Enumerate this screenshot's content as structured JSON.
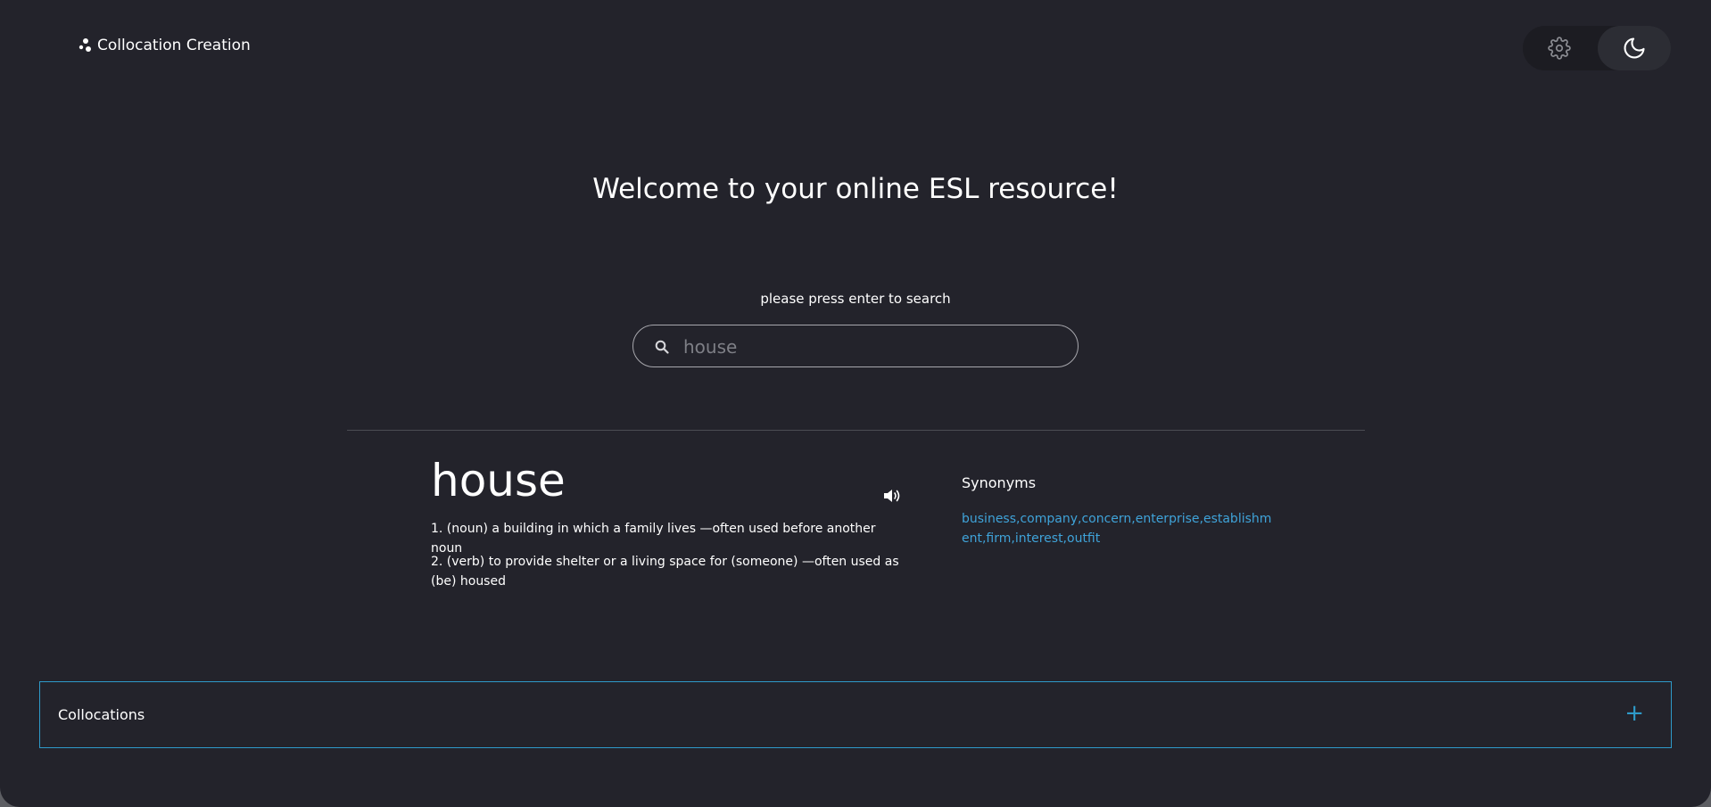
{
  "header": {
    "app_name": "Collocation Creation",
    "logo_icon": "dots-logo-icon",
    "settings_icon": "gear-icon",
    "theme_icon": "moon-icon"
  },
  "main": {
    "title": "Welcome to your online ESL resource!",
    "hint": "please press enter to search",
    "search": {
      "placeholder": "house",
      "value": "",
      "icon": "search-icon"
    }
  },
  "result": {
    "word": "house",
    "audio_icon": "speaker-icon",
    "definitions": [
      "1. (noun) a building in which a family lives —often used before another noun",
      "2. (verb) to provide shelter or a living space for (someone) —often used as (be) housed"
    ],
    "synonyms_heading": "Synonyms",
    "synonyms": "business,company,concern,enterprise,establishment,firm,interest,outfit"
  },
  "collocations": {
    "label": "Collocations",
    "toggle": "+"
  },
  "colors": {
    "background": "#23232b",
    "accent": "#2e9ac9",
    "link": "#3fa3d9"
  }
}
